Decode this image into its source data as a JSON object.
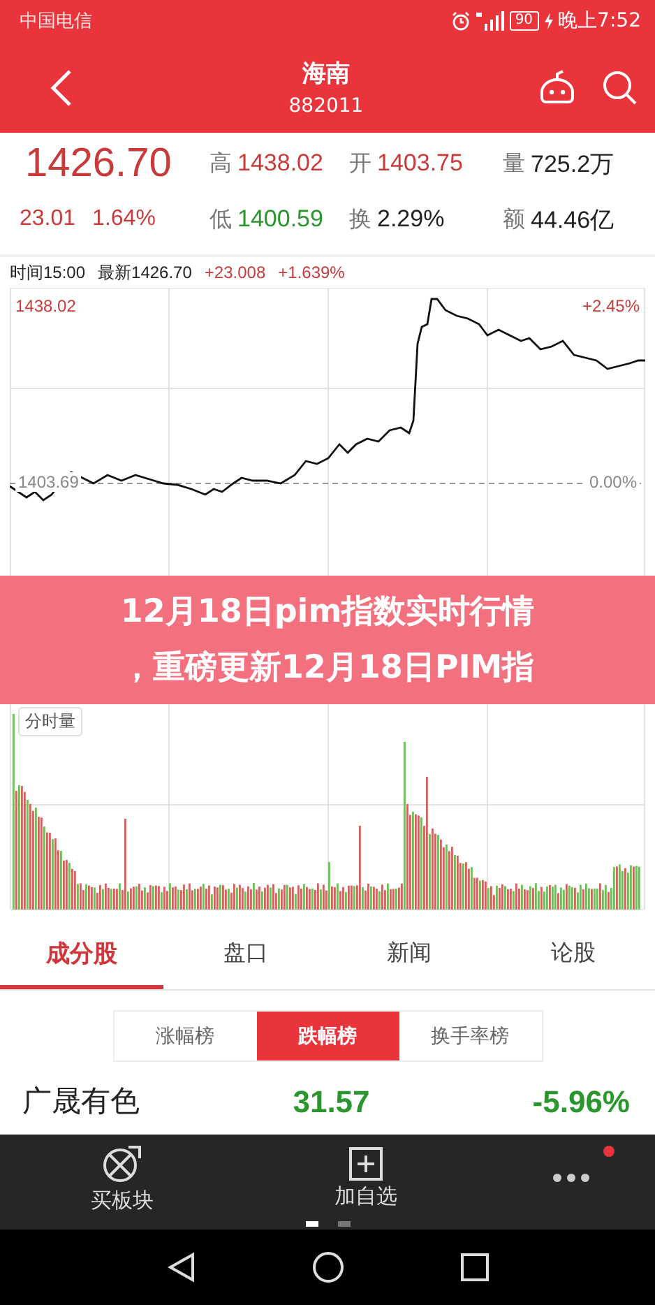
{
  "status_bar": {
    "carrier": "中国电信",
    "battery": "90",
    "time": "晚上7:52"
  },
  "header": {
    "title": "海南",
    "code": "882011"
  },
  "quote": {
    "price": "1426.70",
    "change": "23.01",
    "change_pct": "1.64%",
    "stats": [
      {
        "label": "高",
        "value": "1438.02",
        "color": "#c93a3a"
      },
      {
        "label": "开",
        "value": "1403.75",
        "color": "#c93a3a"
      },
      {
        "label": "量",
        "value": "725.2万",
        "color": "#222222"
      },
      {
        "label": "低",
        "value": "1400.59",
        "color": "#2a962d"
      },
      {
        "label": "换",
        "value": "2.29%",
        "color": "#222222"
      },
      {
        "label": "额",
        "value": "44.46亿",
        "color": "#222222"
      }
    ]
  },
  "chart": {
    "time": "时间15:00",
    "latest": "最新1426.70",
    "change": "+23.008",
    "change_pct": "+1.639%",
    "high": "1438.02",
    "high_pct": "+2.45%",
    "base": "1403.69",
    "base_pct": "0.00%",
    "volume_tag": "分时量"
  },
  "banner": {
    "lines": [
      "12月18日pim指数实时行情",
      "，重磅更新12月18日PIM指"
    ]
  },
  "tabs": [
    {
      "label": "成分股",
      "selected": true
    },
    {
      "label": "盘口",
      "selected": false
    },
    {
      "label": "新闻",
      "selected": false
    },
    {
      "label": "论股",
      "selected": false
    }
  ],
  "segments": [
    {
      "label": "涨幅榜",
      "selected": false
    },
    {
      "label": "跌幅榜",
      "selected": true
    },
    {
      "label": "换手率榜",
      "selected": false
    }
  ],
  "stocks": [
    {
      "name": "广晟有色",
      "price": "31.57",
      "change": "-5.96%"
    }
  ],
  "actions": [
    {
      "kind": "ball",
      "label": "买板块"
    },
    {
      "kind": "plus",
      "label": "加自选"
    },
    {
      "kind": "more",
      "badge": true
    }
  ],
  "pages": [
    {
      "selected": true
    },
    {
      "selected": false
    }
  ]
}
